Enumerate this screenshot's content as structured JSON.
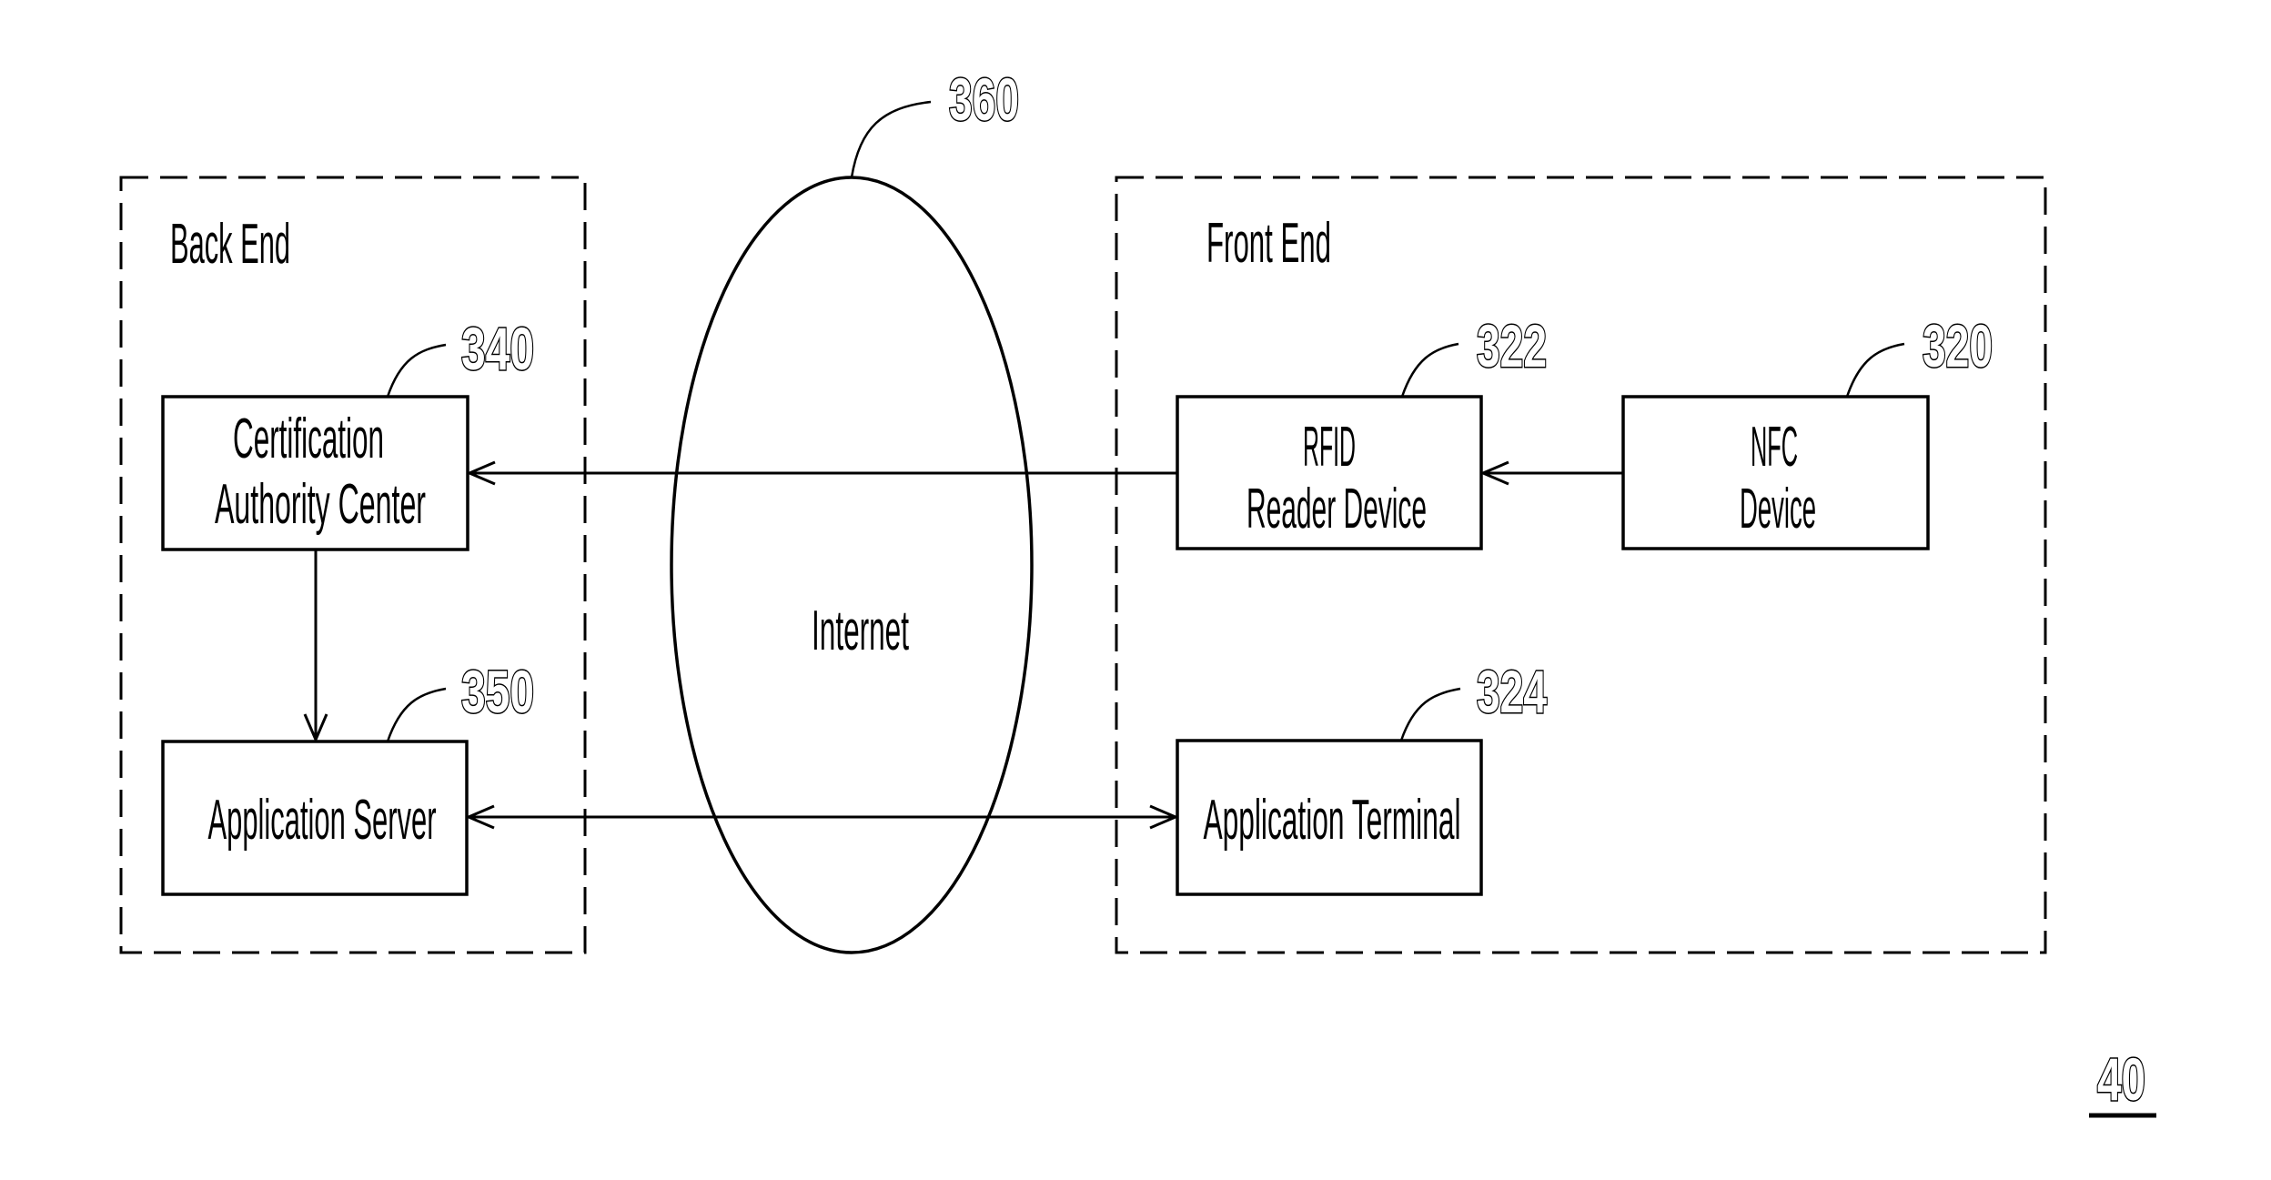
{
  "diagram": {
    "figure_number": "40",
    "regions": {
      "back_end": {
        "label": "Back End"
      },
      "front_end": {
        "label": "Front End"
      }
    },
    "network": {
      "label": "Internet",
      "ref": "360"
    },
    "nodes": {
      "ca_center": {
        "lines": [
          "Certification",
          "Authority Center"
        ],
        "ref": "340"
      },
      "app_server": {
        "lines": [
          "Application Server"
        ],
        "ref": "350"
      },
      "rfid_reader": {
        "lines": [
          "RFID",
          "Reader Device"
        ],
        "ref": "322"
      },
      "nfc_device": {
        "lines": [
          "NFC",
          "Device"
        ],
        "ref": "320"
      },
      "app_terminal": {
        "lines": [
          "Application Terminal"
        ],
        "ref": "324"
      }
    },
    "edges": [
      {
        "from": "nfc_device",
        "to": "rfid_reader",
        "direction": "one-way"
      },
      {
        "from": "rfid_reader",
        "to": "ca_center",
        "direction": "one-way",
        "via": "Internet"
      },
      {
        "from": "ca_center",
        "to": "app_server",
        "direction": "one-way"
      },
      {
        "from": "app_server",
        "to": "app_terminal",
        "direction": "two-way",
        "via": "Internet"
      }
    ]
  }
}
